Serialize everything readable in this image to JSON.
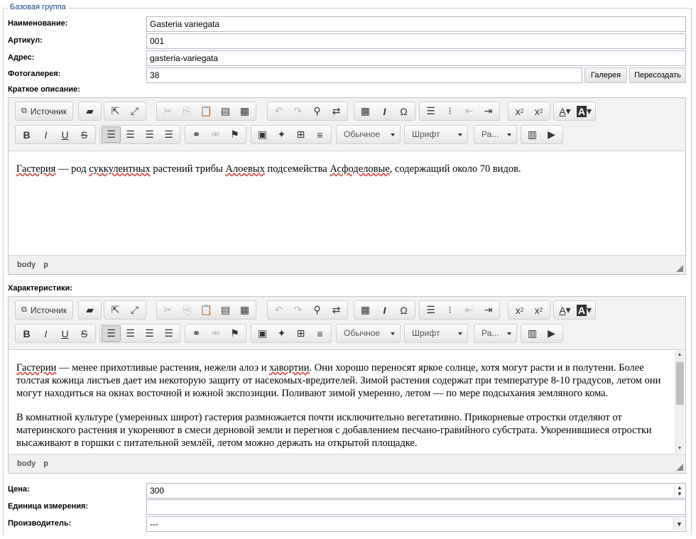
{
  "fieldset": {
    "legend": "Базовая группа"
  },
  "fields": {
    "name": {
      "label": "Наименование:",
      "value": "Gasteria variegata"
    },
    "article": {
      "label": "Артикул:",
      "value": "001"
    },
    "address": {
      "label": "Адрес:",
      "value": "gasteria-variegata"
    },
    "gallery": {
      "label": "Фотогалерея:",
      "value": "38",
      "gallery_button": "Галерея",
      "recreate_button": "Пересоздать"
    },
    "short_desc": {
      "label": "Краткое описание:"
    },
    "characteristics": {
      "label": "Характеристики:"
    },
    "price": {
      "label": "Цена:",
      "value": "300"
    },
    "unit": {
      "label": "Единица измерения:",
      "value": ""
    },
    "manufacturer": {
      "label": "Производитель:",
      "value": "---"
    }
  },
  "toolbar": {
    "source_label": "Источник",
    "format_combo": "Обычное",
    "font_combo": "Шрифт",
    "size_combo": "Ра...",
    "icons": {
      "source": "source-icon",
      "comment": "comment-icon",
      "popout": "popout-icon",
      "maximize": "maximize-icon",
      "cut": "cut-icon",
      "copy": "copy-icon",
      "paste": "paste-icon",
      "paste_text": "paste-text-icon",
      "paste_word": "paste-word-icon",
      "undo": "undo-icon",
      "redo": "redo-icon",
      "find": "find-icon",
      "replace": "replace-icon",
      "select_all": "select-all-icon",
      "remove_format": "remove-format-icon",
      "special_char": "special-char-icon",
      "numbered_list": "numbered-list-icon",
      "bulleted_list": "bulleted-list-icon",
      "outdent": "outdent-icon",
      "indent": "indent-icon",
      "subscript": "subscript-icon",
      "superscript": "superscript-icon",
      "text_color": "text-color-icon",
      "bg_color": "bg-color-icon",
      "bold": "bold-icon",
      "italic": "italic-icon",
      "underline": "underline-icon",
      "strike": "strike-icon",
      "align_left": "align-left-icon",
      "align_center": "align-center-icon",
      "align_right": "align-right-icon",
      "justify": "justify-icon",
      "link": "link-icon",
      "unlink": "unlink-icon",
      "anchor": "anchor-icon",
      "image": "image-icon",
      "flash": "flash-icon",
      "table": "table-icon",
      "hr": "horizontal-rule-icon",
      "video": "video-icon",
      "media": "media-icon"
    }
  },
  "editor1": {
    "paragraphs": [
      [
        {
          "t": "Гастерия",
          "sp": true
        },
        {
          "t": " — род "
        },
        {
          "t": "суккулентных",
          "sp": true
        },
        {
          "t": " растений трибы "
        },
        {
          "t": "Алоевых",
          "sp": true
        },
        {
          "t": " подсемейства "
        },
        {
          "t": "Асфоделовые",
          "sp": true
        },
        {
          "t": ", содержащий около 70 видов."
        }
      ]
    ],
    "path": [
      "body",
      "p"
    ]
  },
  "editor2": {
    "paragraphs": [
      [
        {
          "t": "Гастерии",
          "sp": true
        },
        {
          "t": " — менее прихотливые растения, нежели алоэ и "
        },
        {
          "t": "хавортии",
          "sp": true
        },
        {
          "t": ". Они хорошо переносят яркое солнце, хотя могут расти и в полутени. Более толстая кожица листьев дает им некоторую защиту от насекомых-вредителей. Зимой растения содержат при температуре 8-10 градусов, летом они могут находиться на окнах восточной и южной экспозиции. Поливают зимой умеренно, летом — по мере подсыхания земляного кома."
        }
      ],
      [
        {
          "t": "В комнатной культуре (умеренных широт) гастерия размножается почти исключительно вегетативно. Прикорневые отростки отделяют от материнского растения и укореняют в смеси дерновой земли и перегноя с добавлением песчано-гравийного субстрата. Укоренившиеся отростки высаживают в горшки с питательной землёй, летом можно держать на открытой площадке."
        }
      ]
    ],
    "path": [
      "body",
      "p"
    ]
  }
}
